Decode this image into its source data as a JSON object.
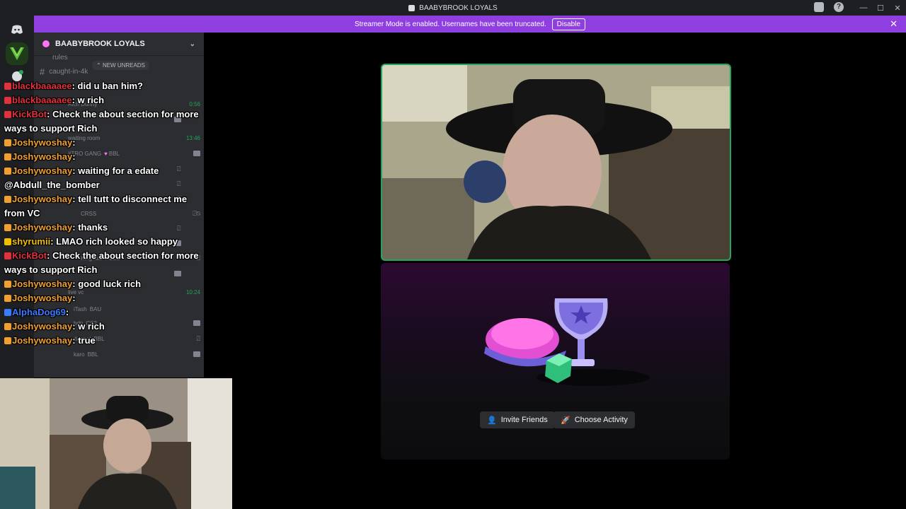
{
  "window": {
    "title": "BAABYBROOK LOYALS",
    "controls": [
      "—",
      "☐",
      "✕"
    ]
  },
  "banner": {
    "text": "Streamer Mode is enabled. Usernames have been truncated.",
    "button": "Disable"
  },
  "server": {
    "name": "BAABYBROOK LOYALS",
    "new_unreads": "NEW UNREADS",
    "channels": [
      {
        "name": "rules"
      },
      {
        "name": "caught-in-4k"
      }
    ]
  },
  "voice_members": [
    {
      "name": "Rich Dunny",
      "ts": "0:56"
    },
    {
      "name": "waiting room",
      "ts": "13:46"
    },
    {
      "name": "#TRO GANG",
      "tag": "BBL"
    },
    {
      "name": "CRSS"
    },
    {
      "name": "KingTutt",
      "tag": "BBL"
    },
    {
      "name": "live vc",
      "ts": "10:24"
    },
    {
      "name": "iTash",
      "tag": "BAU"
    },
    {
      "name": "bdn",
      "tag": "CS2"
    },
    {
      "name": "dagnat",
      "tag": "BBL"
    },
    {
      "name": "karo",
      "tag": "BBL"
    }
  ],
  "chat": [
    {
      "user": "blackbaaaaee",
      "msg": ": did u ban him?",
      "color": "#e0313c"
    },
    {
      "user": "blackbaaaaee",
      "msg": ": w rich",
      "color": "#e0313c"
    },
    {
      "user": "KickBot",
      "msg": ": Check the about section for more ways to support Rich",
      "color": "#e0313c"
    },
    {
      "user": "Joshywoshay",
      "msg": ":",
      "color": "#f0a030"
    },
    {
      "user": "Joshywoshay",
      "msg": ":",
      "color": "#f0a030"
    },
    {
      "user": "Joshywoshay",
      "msg": ": waiting for a edate @Abdull_the_bomber",
      "color": "#f0a030"
    },
    {
      "user": "Joshywoshay",
      "msg": ": tell tutt to disconnect me from VC",
      "color": "#f0a030"
    },
    {
      "user": "Joshywoshay",
      "msg": ": thanks",
      "color": "#f0a030"
    },
    {
      "user": "shyrumii",
      "msg": ": LMAO rich looked so happy",
      "color": "#f0c000"
    },
    {
      "user": "KickBot",
      "msg": ": Check the about section for more ways to support Rich",
      "color": "#e0313c"
    },
    {
      "user": "Joshywoshay",
      "msg": ": good luck rich",
      "color": "#f0a030"
    },
    {
      "user": "Joshywoshay",
      "msg": ":",
      "color": "#f0a030"
    },
    {
      "user": "AlphaDog69",
      "msg": ":",
      "color": "#3a7bff"
    },
    {
      "user": "Joshywoshay",
      "msg": ": w rich",
      "color": "#f0a030"
    },
    {
      "user": "Joshywoshay",
      "msg": ": true",
      "color": "#f0a030"
    }
  ],
  "activity": {
    "invite_label": "Invite Friends",
    "choose_label": "Choose Activity"
  },
  "colors": {
    "accent": "#8f3fe0",
    "speaking": "#23a55a",
    "bg": "#000000"
  }
}
